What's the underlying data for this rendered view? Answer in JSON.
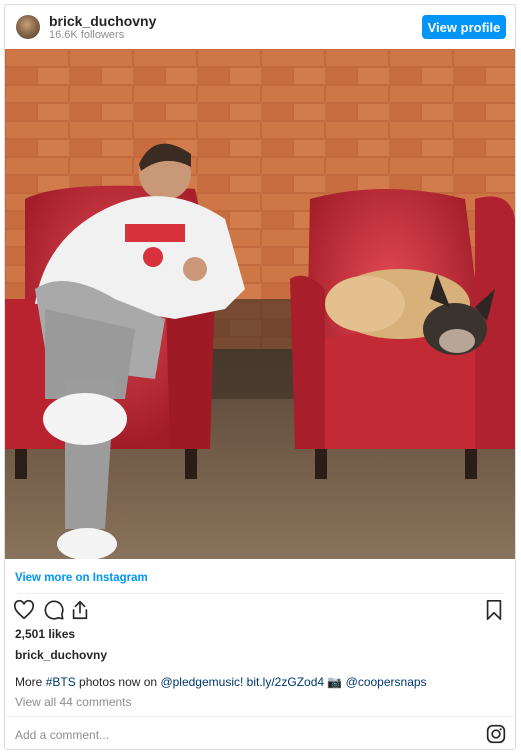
{
  "header": {
    "username": "brick_duchovny",
    "followers": "16.6K followers",
    "view_profile_label": "View profile",
    "avatar_icon": "profile-avatar"
  },
  "photo": {
    "alt": "Man in white hoodie seated on a red leather chair beside a dog resting on another red chair in front of a brick wall"
  },
  "view_more_label": "View more on Instagram",
  "actions": {
    "like_icon": "heart-icon",
    "comment_icon": "comment-icon",
    "share_icon": "share-icon",
    "save_icon": "bookmark-icon"
  },
  "likes": "2,501 likes",
  "caption": {
    "username": "brick_duchovny",
    "text_before": "More ",
    "hashtag": "#BTS",
    "text_mid": " photos now on ",
    "mention1": "@pledgemusic!",
    "space": " ",
    "link": "bit.ly/2zGZod4",
    "camera": " 📷 ",
    "mention2": "@coopersnaps"
  },
  "view_comments": "View all 44 comments",
  "comment_placeholder": "Add a comment...",
  "brand_icon": "instagram-icon",
  "colors": {
    "accent": "#0095f6",
    "link_dark": "#00376b",
    "muted": "#8e8e8e",
    "text": "#262626"
  }
}
